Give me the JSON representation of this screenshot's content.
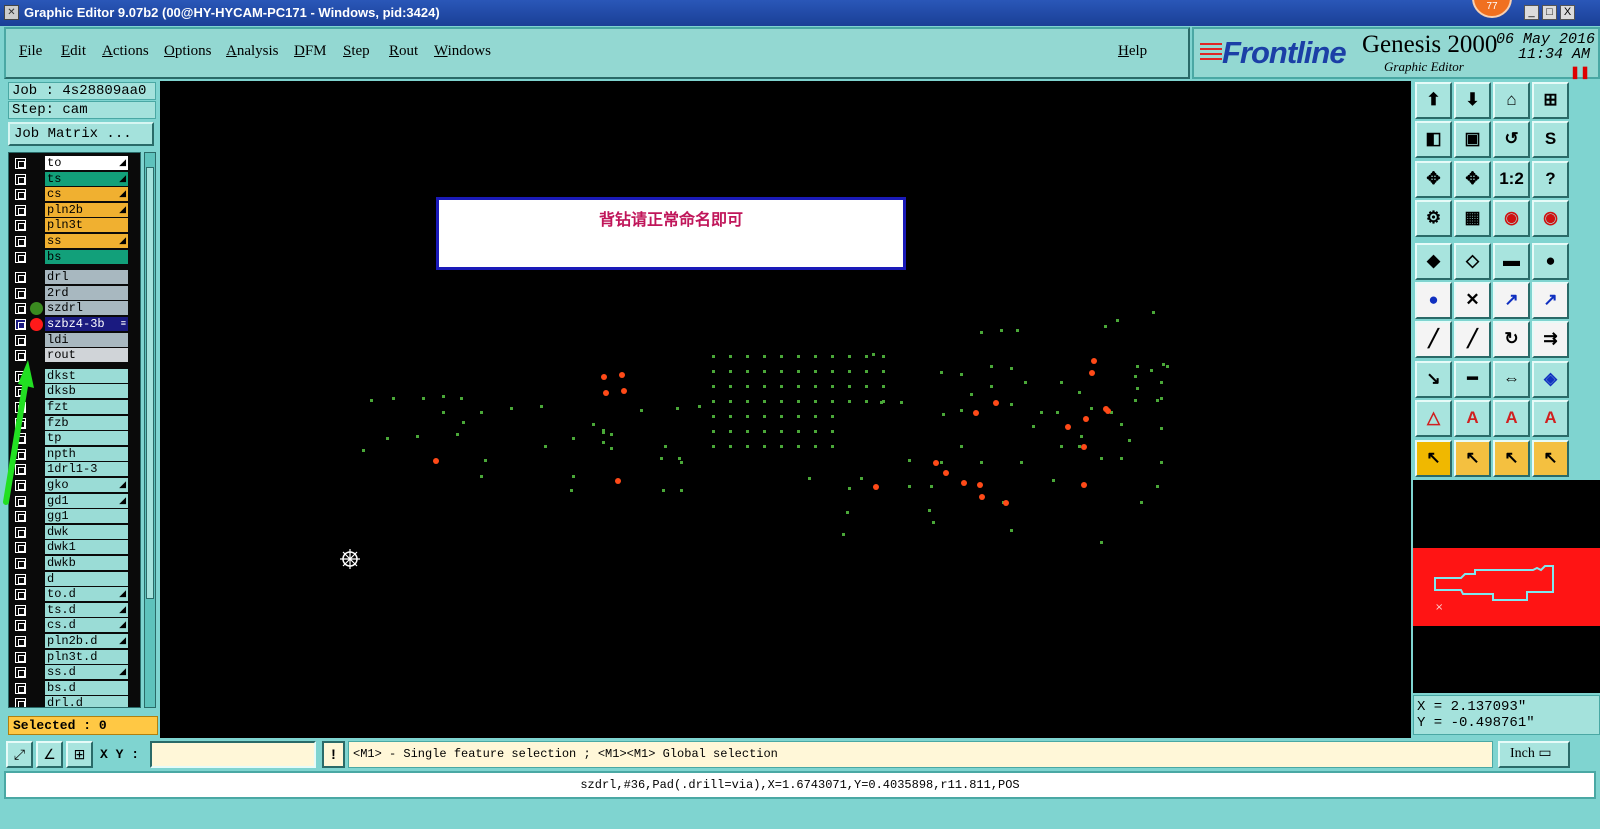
{
  "window": {
    "title": "Graphic Editor 9.07b2 (00@HY-HYCAM-PC171 - Windows, pid:3424)",
    "notification_count": "77",
    "minimize": "_",
    "maximize": "□",
    "close": "X"
  },
  "menu": {
    "items": [
      "File",
      "Edit",
      "Actions",
      "Options",
      "Analysis",
      "DFM",
      "Step",
      "Rout",
      "Windows"
    ],
    "help": "Help"
  },
  "brand": {
    "logo": "Frontline",
    "product": "Genesis 2000",
    "subtitle": "Graphic Editor",
    "date": "06 May 2016",
    "time": "11:34 AM"
  },
  "job": {
    "job_line": "Job : 4s28809aa0",
    "step_line": "Step: cam",
    "matrix_button": "Job Matrix ..."
  },
  "layers": [
    {
      "name": "to",
      "color": "#ffffff",
      "mark": "◢"
    },
    {
      "name": "ts",
      "color": "#12a07a",
      "mark": "◢"
    },
    {
      "name": "cs",
      "color": "#f0b030",
      "mark": "◢"
    },
    {
      "name": "pln2b",
      "color": "#f0b030",
      "mark": "◢"
    },
    {
      "name": "pln3t",
      "color": "#f0b030",
      "mark": ""
    },
    {
      "name": "ss",
      "color": "#f0b030",
      "mark": "◢"
    },
    {
      "name": "bs",
      "color": "#12a07a",
      "mark": ""
    },
    {
      "name": "drl",
      "color": "#a8b8c0",
      "mark": ""
    },
    {
      "name": "2rd",
      "color": "#a8b8c0",
      "mark": ""
    },
    {
      "name": "szdrl",
      "color": "#a8b8c0",
      "mark": "",
      "dot": "#3a8a20"
    },
    {
      "name": "szbz4-3b",
      "color": "#1a1a80",
      "mark": "≡",
      "dot": "#ff1a1a",
      "selected": true
    },
    {
      "name": "ldi",
      "color": "#a8b8c0",
      "mark": ""
    },
    {
      "name": "rout",
      "color": "#d0d4d8",
      "mark": ""
    },
    {
      "name": "dkst",
      "color": "#9adcd6",
      "mark": ""
    },
    {
      "name": "dksb",
      "color": "#9adcd6",
      "mark": ""
    },
    {
      "name": "fzt",
      "color": "#9adcd6",
      "mark": ""
    },
    {
      "name": "fzb",
      "color": "#9adcd6",
      "mark": ""
    },
    {
      "name": "tp",
      "color": "#9adcd6",
      "mark": ""
    },
    {
      "name": "npth",
      "color": "#9adcd6",
      "mark": ""
    },
    {
      "name": "1drl1-3",
      "color": "#9adcd6",
      "mark": ""
    },
    {
      "name": "gko",
      "color": "#9adcd6",
      "mark": "◢"
    },
    {
      "name": "gd1",
      "color": "#9adcd6",
      "mark": "◢"
    },
    {
      "name": "gg1",
      "color": "#9adcd6",
      "mark": ""
    },
    {
      "name": "dwk",
      "color": "#9adcd6",
      "mark": ""
    },
    {
      "name": "dwk1",
      "color": "#9adcd6",
      "mark": ""
    },
    {
      "name": "dwkb",
      "color": "#9adcd6",
      "mark": ""
    },
    {
      "name": "d",
      "color": "#9adcd6",
      "mark": ""
    },
    {
      "name": "to.d",
      "color": "#9adcd6",
      "mark": "◢"
    },
    {
      "name": "ts.d",
      "color": "#9adcd6",
      "mark": "◢"
    },
    {
      "name": "cs.d",
      "color": "#9adcd6",
      "mark": "◢"
    },
    {
      "name": "pln2b.d",
      "color": "#9adcd6",
      "mark": "◢"
    },
    {
      "name": "pln3t.d",
      "color": "#9adcd6",
      "mark": ""
    },
    {
      "name": "ss.d",
      "color": "#9adcd6",
      "mark": "◢"
    },
    {
      "name": "bs.d",
      "color": "#9adcd6",
      "mark": ""
    },
    {
      "name": "drl.d",
      "color": "#9adcd6",
      "mark": ""
    }
  ],
  "selected_label": "Selected : 0",
  "canvas": {
    "message": "背钻请正常命名即可"
  },
  "toolbar_icons": [
    "zoom-home-icon",
    "zoom-out-icon",
    "home-icon",
    "grid-icon",
    "pan-left-icon",
    "pan-right-icon",
    "undo-pan-icon",
    "snap-icon",
    "fit-icon",
    "zoom-fit-icon",
    "scale-icon",
    "help-icon",
    "measure-icon",
    "panel-icon",
    "red-layer-icon",
    "red-layer2-icon",
    "pad-icon",
    "line-icon",
    "ruler-icon",
    "circle-icon",
    "connect-icon",
    "cross-icon",
    "arrow-icon",
    "arrow2-icon",
    "slash-icon",
    "slash2-icon",
    "arc-icon",
    "double-bar-icon",
    "move-icon",
    "cut-icon",
    "box-icon",
    "blue-square-icon",
    "triangle-icon",
    "triangle2-icon",
    "letter-a-icon",
    "letter-a2-icon",
    "pointer-icon",
    "pointer2-icon",
    "pointer3-icon",
    "pointer4-icon"
  ],
  "toolbar_glyphs": [
    "⬆",
    "⬇",
    "⌂",
    "⊞",
    "◧",
    "▣",
    "↺",
    "S",
    "✥",
    "✥",
    "1:2",
    "?",
    "⚙",
    "▦",
    "◉",
    "◉",
    "◆",
    "◇",
    "▬",
    "●",
    "●",
    "✕",
    "↗",
    "↗",
    "╱",
    "╱",
    "↻",
    "⇉",
    "↘",
    "━",
    "⇔",
    "◈",
    "△",
    "A",
    "A",
    "A",
    "↖",
    "↖",
    "↖",
    "↖"
  ],
  "coords": {
    "x": "X = 2.137093\"",
    "y": "Y = -0.498761\""
  },
  "bottom": {
    "xy_label": "X Y :",
    "xy_value": "",
    "bang": "!",
    "hint": "<M1> - Single feature selection ; <M1><M1> Global selection",
    "units": "Inch ▭"
  },
  "status": "szdrl,#36,Pad(.drill=via),X=1.6743071,Y=0.4035898,r11.811,POS"
}
